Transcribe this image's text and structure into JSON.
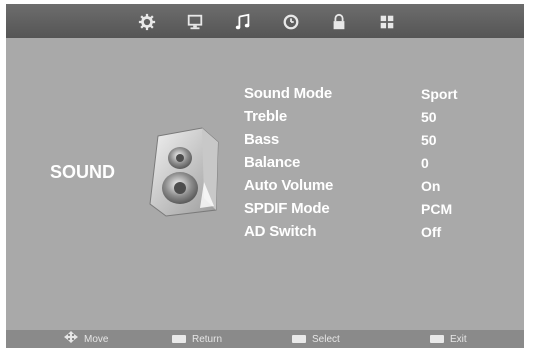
{
  "top_tabs": [
    {
      "icon": "gear-icon"
    },
    {
      "icon": "monitor-icon"
    },
    {
      "icon": "music-note-icon"
    },
    {
      "icon": "clock-icon"
    },
    {
      "icon": "lock-icon"
    },
    {
      "icon": "grid-icon"
    }
  ],
  "section": {
    "title": "SOUND",
    "icon": "speaker-icon"
  },
  "menu": [
    {
      "label": "Sound Mode",
      "value": "Sport"
    },
    {
      "label": "Treble",
      "value": "50"
    },
    {
      "label": "Bass",
      "value": "50"
    },
    {
      "label": "Balance",
      "value": "0"
    },
    {
      "label": "Auto Volume",
      "value": "On"
    },
    {
      "label": "SPDIF Mode",
      "value": "PCM"
    },
    {
      "label": "AD Switch",
      "value": "Off"
    }
  ],
  "hints": [
    {
      "icon": "move-arrows-icon",
      "label": "Move"
    },
    {
      "icon": "menu-key-icon",
      "label": "Return"
    },
    {
      "icon": "ok-key-icon",
      "label": "Select"
    },
    {
      "icon": "exit-key-icon",
      "label": "Exit"
    }
  ],
  "colors": {
    "panel": "#a9a9a9",
    "topbar": "#5f5f5f",
    "text": "#ffffff"
  }
}
